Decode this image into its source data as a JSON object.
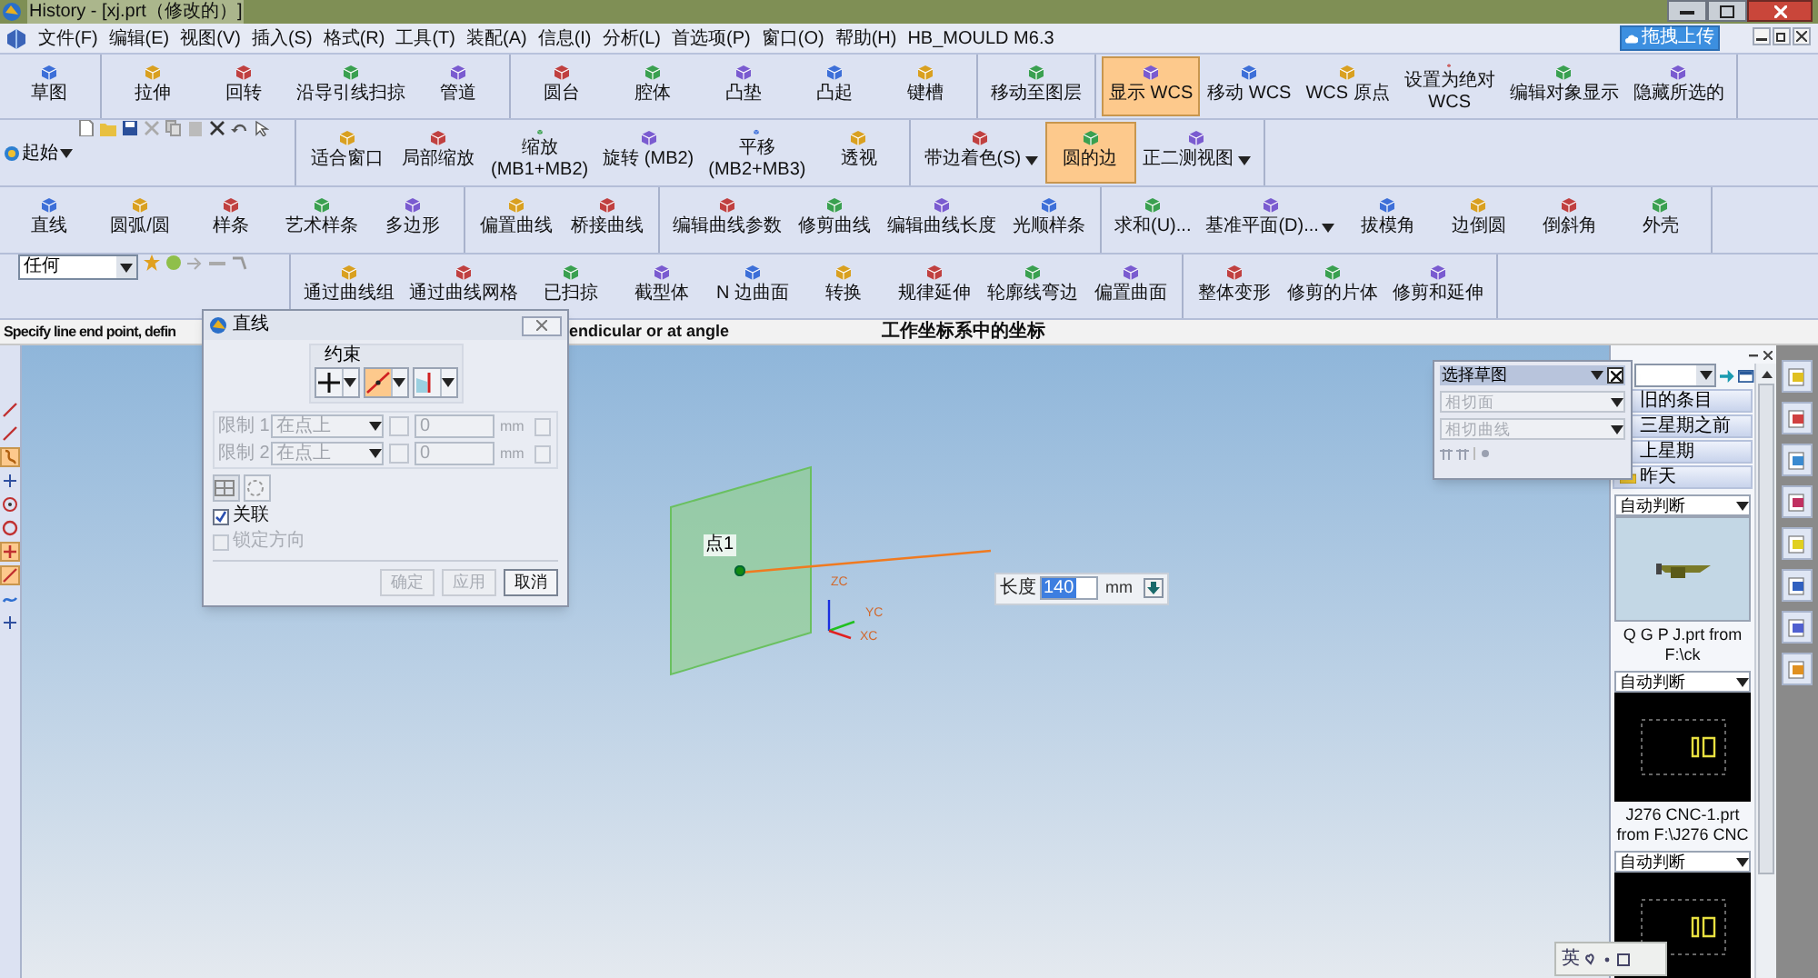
{
  "window": {
    "title": "History - [xj.prt（修改的）]"
  },
  "menu": [
    "文件(F)",
    "编辑(E)",
    "视图(V)",
    "插入(S)",
    "格式(R)",
    "工具(T)",
    "装配(A)",
    "信息(I)",
    "分析(L)",
    "首选项(P)",
    "窗口(O)",
    "帮助(H)",
    "HB_MOULD M6.3"
  ],
  "upload_button": "拖拽上传",
  "toolbars": [
    {
      "groups": [
        {
          "kind": "buttons",
          "items": [
            {
              "lines": [
                "草图"
              ],
              "selected": false
            }
          ]
        },
        {
          "kind": "buttons",
          "items": [
            {
              "lines": [
                "拉伸"
              ],
              "selected": false
            },
            {
              "lines": [
                "回转"
              ],
              "selected": false
            },
            {
              "lines": [
                "沿导引线扫掠"
              ],
              "selected": false
            },
            {
              "lines": [
                "管道"
              ],
              "selected": false
            }
          ]
        },
        {
          "kind": "buttons",
          "items": [
            {
              "lines": [
                "圆台"
              ],
              "selected": false
            },
            {
              "lines": [
                "腔体"
              ],
              "selected": false
            },
            {
              "lines": [
                "凸垫"
              ],
              "selected": false
            },
            {
              "lines": [
                "凸起"
              ],
              "selected": false
            },
            {
              "lines": [
                "键槽"
              ],
              "selected": false
            }
          ]
        },
        {
          "kind": "buttons",
          "items": [
            {
              "lines": [
                "移动至图层"
              ],
              "selected": false
            }
          ]
        },
        {
          "kind": "buttons",
          "items": [
            {
              "lines": [
                "显示 WCS"
              ],
              "selected": true
            },
            {
              "lines": [
                "移动 WCS"
              ],
              "selected": false
            },
            {
              "lines": [
                "WCS 原点"
              ],
              "selected": false
            },
            {
              "lines": [
                "设置为绝对",
                "WCS"
              ],
              "selected": false
            },
            {
              "lines": [
                "编辑对象显示"
              ],
              "selected": false
            },
            {
              "lines": [
                "隐藏所选的"
              ],
              "selected": false
            }
          ]
        }
      ]
    },
    {
      "groups": [
        {
          "kind": "quick",
          "label": "起始"
        },
        {
          "kind": "buttons",
          "items": [
            {
              "lines": [
                "适合窗口"
              ],
              "selected": false
            },
            {
              "lines": [
                "局部缩放"
              ],
              "selected": false
            },
            {
              "lines": [
                "缩放",
                "(MB1+MB2)"
              ],
              "selected": false
            },
            {
              "lines": [
                "旋转 (MB2)"
              ],
              "selected": false
            },
            {
              "lines": [
                "平移",
                "(MB2+MB3)"
              ],
              "selected": false
            },
            {
              "lines": [
                "透视"
              ],
              "selected": false
            }
          ]
        },
        {
          "kind": "buttons",
          "items": [
            {
              "lines": [
                "带边着色(S)"
              ],
              "selected": false,
              "dropdown": true
            },
            {
              "lines": [
                "圆的边"
              ],
              "selected": true
            },
            {
              "lines": [
                "正二测视图"
              ],
              "selected": false,
              "dropdown": true
            }
          ]
        }
      ]
    },
    {
      "groups": [
        {
          "kind": "buttons",
          "items": [
            {
              "lines": [
                "直线"
              ],
              "selected": false
            },
            {
              "lines": [
                "圆弧/圆"
              ],
              "selected": false
            },
            {
              "lines": [
                "样条"
              ],
              "selected": false
            },
            {
              "lines": [
                "艺术样条"
              ],
              "selected": false
            },
            {
              "lines": [
                "多边形"
              ],
              "selected": false
            }
          ]
        },
        {
          "kind": "buttons",
          "items": [
            {
              "lines": [
                "偏置曲线"
              ],
              "selected": false
            },
            {
              "lines": [
                "桥接曲线"
              ],
              "selected": false
            }
          ]
        },
        {
          "kind": "buttons",
          "items": [
            {
              "lines": [
                "编辑曲线参数"
              ],
              "selected": false
            },
            {
              "lines": [
                "修剪曲线"
              ],
              "selected": false
            },
            {
              "lines": [
                "编辑曲线长度"
              ],
              "selected": false
            },
            {
              "lines": [
                "光顺样条"
              ],
              "selected": false
            }
          ]
        },
        {
          "kind": "buttons",
          "items": [
            {
              "lines": [
                "求和(U)..."
              ],
              "selected": false
            },
            {
              "lines": [
                "基准平面(D)..."
              ],
              "selected": false,
              "dropdown": true
            },
            {
              "lines": [
                "拔模角"
              ],
              "selected": false
            },
            {
              "lines": [
                "边倒圆"
              ],
              "selected": false
            },
            {
              "lines": [
                "倒斜角"
              ],
              "selected": false
            },
            {
              "lines": [
                "外壳"
              ],
              "selected": false
            }
          ]
        }
      ]
    },
    {
      "groups": [
        {
          "kind": "filter",
          "value": "任何"
        },
        {
          "kind": "buttons",
          "items": [
            {
              "lines": [
                "通过曲线组"
              ],
              "selected": false
            },
            {
              "lines": [
                "通过曲线网格"
              ],
              "selected": false
            },
            {
              "lines": [
                "已扫掠"
              ],
              "selected": false
            },
            {
              "lines": [
                "截型体"
              ],
              "selected": false
            },
            {
              "lines": [
                "N 边曲面"
              ],
              "selected": false
            },
            {
              "lines": [
                "转换"
              ],
              "selected": false
            },
            {
              "lines": [
                "规律延伸"
              ],
              "selected": false
            },
            {
              "lines": [
                "轮廓线弯边"
              ],
              "selected": false
            },
            {
              "lines": [
                "偏置曲面"
              ],
              "selected": false
            }
          ]
        },
        {
          "kind": "buttons",
          "items": [
            {
              "lines": [
                "整体变形"
              ],
              "selected": false
            },
            {
              "lines": [
                "修剪的片体"
              ],
              "selected": false
            },
            {
              "lines": [
                "修剪和延伸"
              ],
              "selected": false
            }
          ]
        }
      ]
    }
  ],
  "status_bar": {
    "prompt_left": "Specify line end point, defin",
    "prompt_right": "endicular or at angle",
    "coordinates": "工作坐标系中的坐标"
  },
  "left_tools": [
    {
      "kind": "line",
      "selected": false
    },
    {
      "kind": "line",
      "selected": false
    },
    {
      "kind": "curve",
      "selected": true
    },
    {
      "kind": "cross",
      "selected": false
    },
    {
      "kind": "ring",
      "selected": false
    },
    {
      "kind": "circle",
      "selected": false
    },
    {
      "kind": "plus",
      "selected": true
    },
    {
      "kind": "line",
      "selected": true
    },
    {
      "kind": "wave",
      "selected": false
    },
    {
      "kind": "cross",
      "selected": false
    }
  ],
  "line_dialog": {
    "title": "直线",
    "constraint_label": "约束",
    "constraint_buttons": [
      {
        "kind": "plus",
        "selected": false
      },
      {
        "kind": "tangent",
        "selected": true
      },
      {
        "kind": "axis",
        "selected": false
      }
    ],
    "limits": [
      {
        "label": "限制 1",
        "option": "在点上",
        "value": "0",
        "unit": "mm",
        "disabled": true
      },
      {
        "label": "限制 2",
        "option": "在点上",
        "value": "0",
        "unit": "mm",
        "disabled": true
      }
    ],
    "options": [
      {
        "label": "关联",
        "checked": true,
        "disabled": false
      },
      {
        "label": "锁定方向",
        "checked": false,
        "disabled": true
      }
    ],
    "buttons": [
      {
        "label": "确定",
        "disabled": true
      },
      {
        "label": "应用",
        "disabled": true
      },
      {
        "label": "取消",
        "disabled": false
      }
    ]
  },
  "selection_dialog": {
    "title": "选择草图",
    "fields": [
      {
        "value": "相切面",
        "disabled": true
      },
      {
        "value": "相切曲线",
        "disabled": true
      }
    ]
  },
  "viewport": {
    "point_label": "点1",
    "axes": [
      "ZC",
      "YC",
      "XC"
    ],
    "length": {
      "label": "长度",
      "value": "140",
      "unit": "mm"
    }
  },
  "resource_panel": {
    "history": [
      {
        "label": "旧的条目",
        "folder": false
      },
      {
        "label": "三星期之前",
        "folder": false
      },
      {
        "label": "上星期",
        "folder": false
      },
      {
        "label": "昨天",
        "folder": true
      }
    ],
    "parts": [
      {
        "filter": "自动判断",
        "kind": "light",
        "caption": "Q G P J.prt from F:\\ck"
      },
      {
        "filter": "自动判断",
        "kind": "dark",
        "caption": "J276 CNC-1.prt from F:\\J276 CNC"
      },
      {
        "filter": "自动判断",
        "kind": "dark"
      }
    ]
  },
  "ime_bar": {
    "label": "英"
  }
}
